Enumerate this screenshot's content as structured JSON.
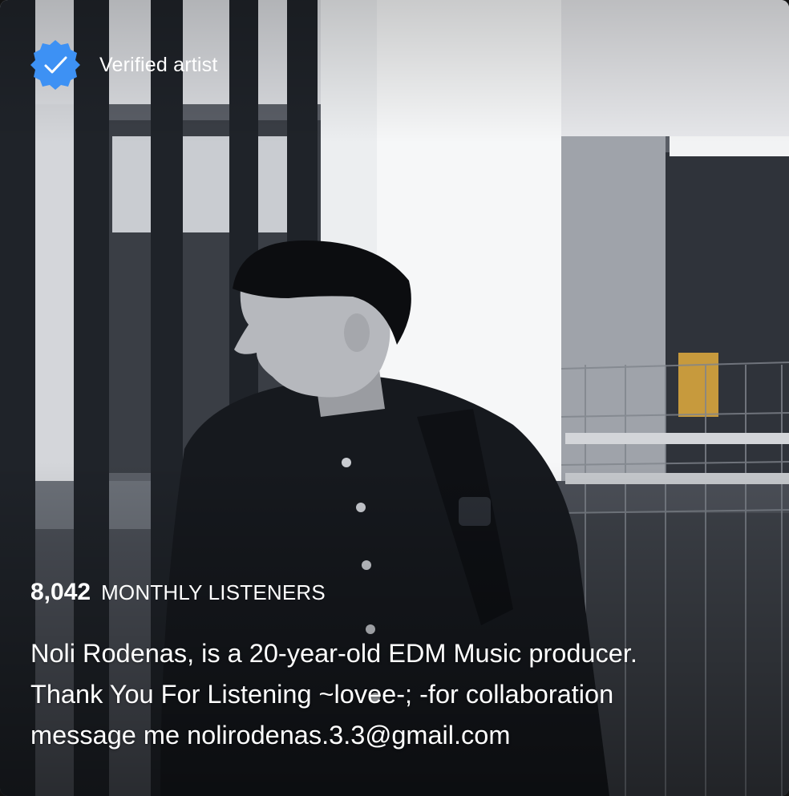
{
  "artist_about": {
    "verified_label": "Verified artist",
    "badge_icon": "verified-check-icon",
    "accent_color": "#3d91f4",
    "monthly_listeners_count": "8,042",
    "monthly_listeners_label": "MONTHLY LISTENERS",
    "bio_lines": [
      "Noli Rodenas, is a 20-year-old EDM Music producer.",
      "Thank You For Listening ~lovee-; -for collaboration",
      "message me nolirodenas.3.3@gmail.com"
    ]
  }
}
